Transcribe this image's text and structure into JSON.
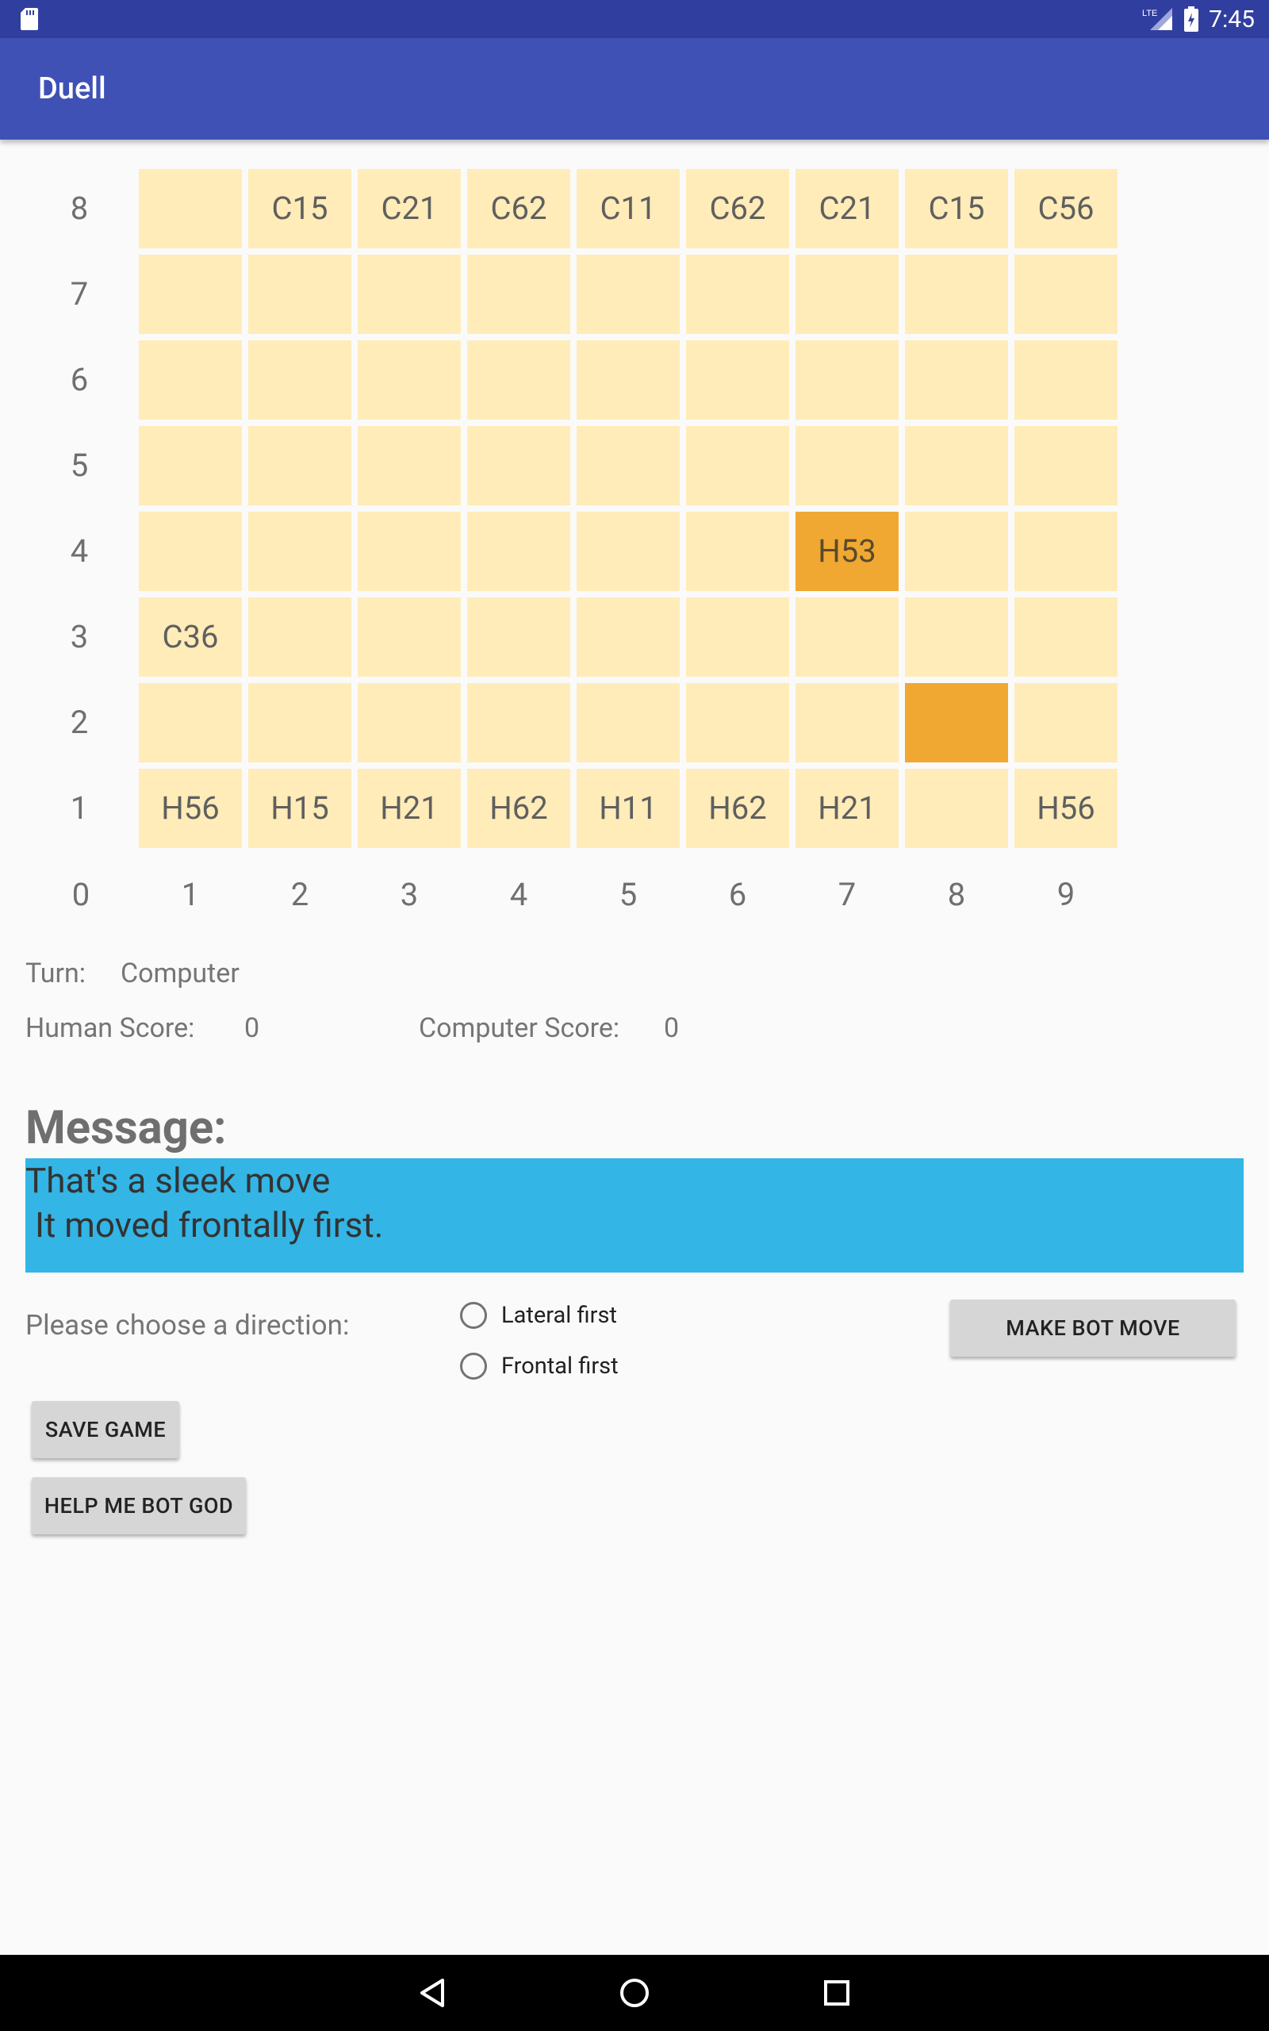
{
  "status_bar": {
    "time": "7:45",
    "icons": [
      "sd-card-icon",
      "lte-signal-icon",
      "battery-icon"
    ]
  },
  "app_bar": {
    "title": "Duell"
  },
  "board": {
    "row_labels": [
      "8",
      "7",
      "6",
      "5",
      "4",
      "3",
      "2",
      "1"
    ],
    "col_labels": [
      "0",
      "1",
      "2",
      "3",
      "4",
      "5",
      "6",
      "7",
      "8",
      "9"
    ],
    "rows": [
      [
        "",
        "C15",
        "C21",
        "C62",
        "C11",
        "C62",
        "C21",
        "C15",
        "C56"
      ],
      [
        "",
        "",
        "",
        "",
        "",
        "",
        "",
        "",
        ""
      ],
      [
        "",
        "",
        "",
        "",
        "",
        "",
        "",
        "",
        ""
      ],
      [
        "",
        "",
        "",
        "",
        "",
        "",
        "",
        "",
        ""
      ],
      [
        "",
        "",
        "",
        "",
        "",
        "",
        "H53",
        "",
        ""
      ],
      [
        "C36",
        "",
        "",
        "",
        "",
        "",
        "",
        "",
        ""
      ],
      [
        "",
        "",
        "",
        "",
        "",
        "",
        "",
        "",
        ""
      ],
      [
        "H56",
        "H15",
        "H21",
        "H62",
        "H11",
        "H62",
        "H21",
        "",
        "H56"
      ]
    ],
    "highlighted_cells": [
      [
        4,
        7
      ],
      [
        2,
        8
      ]
    ],
    "colors": {
      "cell": "#ffecb8",
      "highlight": "#f0a833"
    }
  },
  "info": {
    "turn_label": "Turn:",
    "turn_value": "Computer",
    "human_score_label": "Human Score:",
    "human_score_value": "0",
    "computer_score_label": "Computer Score:",
    "computer_score_value": "0"
  },
  "message": {
    "title": "Message:",
    "line1": "That's a sleek move",
    "line2": "It moved frontally first.",
    "background": "#33b5e5"
  },
  "direction": {
    "prompt": "Please choose a direction:",
    "options": [
      "Lateral first",
      "Frontal first"
    ]
  },
  "buttons": {
    "make_bot_move": "MAKE BOT MOVE",
    "save_game": "SAVE GAME",
    "help_me": "HELP ME BOT GOD"
  },
  "colors": {
    "status_bar": "#303f9f",
    "app_bar": "#3f51b5",
    "button": "#d6d6d6"
  }
}
